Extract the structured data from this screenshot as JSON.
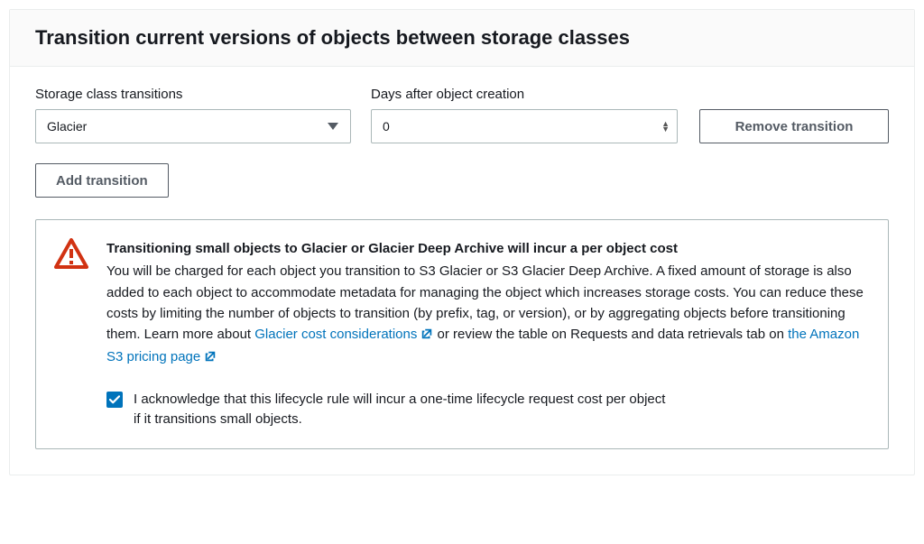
{
  "panel": {
    "title": "Transition current versions of objects between storage classes"
  },
  "fields": {
    "storage_label": "Storage class transitions",
    "storage_value": "Glacier",
    "days_label": "Days after object creation",
    "days_value": "0"
  },
  "buttons": {
    "remove": "Remove transition",
    "add": "Add transition"
  },
  "alert": {
    "title": "Transitioning small objects to Glacier or Glacier Deep Archive will incur a per object cost",
    "body_before_link1": "You will be charged for each object you transition to S3 Glacier or S3 Glacier Deep Archive. A fixed amount of storage is also added to each object to accommodate metadata for managing the object which increases storage costs. You can reduce these costs by limiting the number of objects to transition (by prefix, tag, or version), or by aggregating objects before transitioning them. Learn more about ",
    "link1": "Glacier cost considerations",
    "body_between": " or review the table on Requests and data retrievals tab on ",
    "link2": "the Amazon S3 pricing page",
    "ack": "I acknowledge that this lifecycle rule will incur a one-time lifecycle request cost per object if it transitions small objects.",
    "ack_checked": true
  }
}
